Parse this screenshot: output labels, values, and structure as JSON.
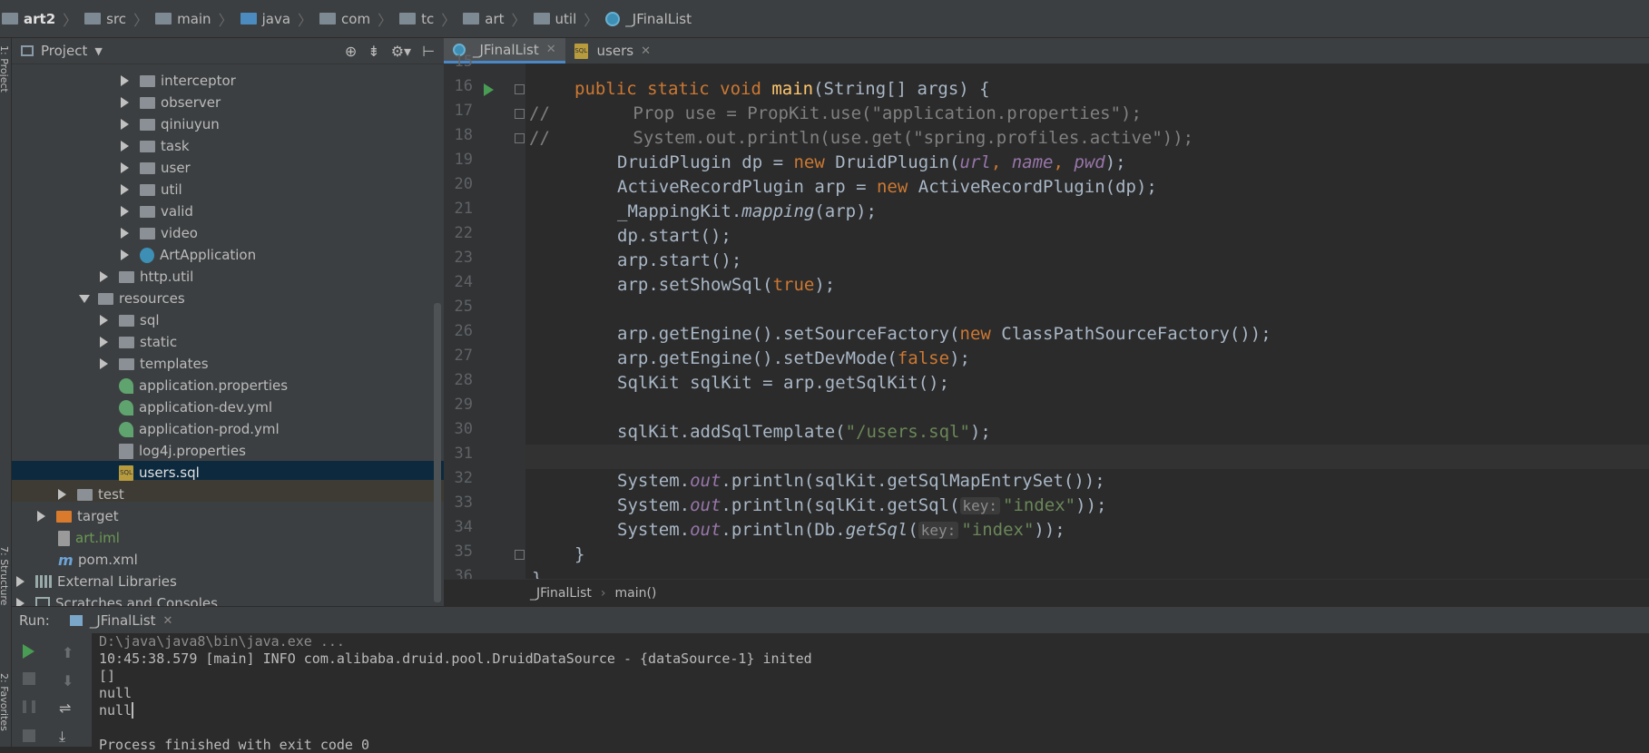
{
  "breadcrumb": {
    "items": [
      "art2",
      "src",
      "main",
      "java",
      "com",
      "tc",
      "art",
      "util",
      "_JFinalList"
    ]
  },
  "side_tabs": {
    "project": "1: Project",
    "structure": "7: Structure",
    "favorites": "2: Favorites"
  },
  "project_panel": {
    "title": "Project",
    "tree": [
      {
        "label": "interceptor",
        "type": "folder"
      },
      {
        "label": "observer",
        "type": "folder"
      },
      {
        "label": "qiniuyun",
        "type": "folder"
      },
      {
        "label": "task",
        "type": "folder"
      },
      {
        "label": "user",
        "type": "folder"
      },
      {
        "label": "util",
        "type": "folder"
      },
      {
        "label": "valid",
        "type": "folder"
      },
      {
        "label": "video",
        "type": "folder"
      },
      {
        "label": "ArtApplication",
        "type": "class"
      },
      {
        "label": "http.util",
        "type": "folder"
      },
      {
        "label": "resources",
        "type": "folder-open"
      },
      {
        "label": "sql",
        "type": "folder"
      },
      {
        "label": "static",
        "type": "folder"
      },
      {
        "label": "templates",
        "type": "folder"
      },
      {
        "label": "application.properties",
        "type": "spring-file"
      },
      {
        "label": "application-dev.yml",
        "type": "spring-file"
      },
      {
        "label": "application-prod.yml",
        "type": "spring-file"
      },
      {
        "label": "log4j.properties",
        "type": "log-file"
      },
      {
        "label": "users.sql",
        "type": "sql-file",
        "selected": true
      },
      {
        "label": "test",
        "type": "folder"
      },
      {
        "label": "target",
        "type": "folder-orange"
      },
      {
        "label": "art.iml",
        "type": "iml-file"
      },
      {
        "label": "pom.xml",
        "type": "maven-file"
      },
      {
        "label": "External Libraries",
        "type": "libraries"
      },
      {
        "label": "Scratches and Consoles",
        "type": "scratches"
      }
    ]
  },
  "editor": {
    "tabs": [
      {
        "label": "_JFinalList",
        "active": true
      },
      {
        "label": "users",
        "active": false
      }
    ],
    "line_numbers": [
      "15",
      "16",
      "17",
      "18",
      "19",
      "20",
      "21",
      "22",
      "23",
      "24",
      "25",
      "26",
      "27",
      "28",
      "29",
      "30",
      "31",
      "32",
      "33",
      "34",
      "35",
      "36"
    ],
    "code": {
      "l16": [
        "public static void ",
        "main",
        "(String[] args) {"
      ],
      "l17": "//        Prop use = PropKit.use(\"application.properties\");",
      "l18": "//        System.out.println(use.get(\"spring.profiles.active\"));",
      "l19": [
        "DruidPlugin dp = ",
        "new ",
        "DruidPlugin(",
        "url",
        ", ",
        "name",
        ", ",
        "pwd",
        ");"
      ],
      "l20": [
        "ActiveRecordPlugin arp = ",
        "new ",
        "ActiveRecordPlugin(dp);"
      ],
      "l21": [
        "_MappingKit.",
        "mapping",
        "(arp);"
      ],
      "l22": "dp.start();",
      "l23": "arp.start();",
      "l24": [
        "arp.setShowSql(",
        "true",
        ");"
      ],
      "l26": [
        "arp.getEngine().setSourceFactory(",
        "new ",
        "ClassPathSourceFactory());"
      ],
      "l27": [
        "arp.getEngine().setDevMode(",
        "false",
        ");"
      ],
      "l28": "SqlKit sqlKit = arp.getSqlKit();",
      "l30": [
        "sqlKit.addSqlTemplate(",
        "\"/users.sql\"",
        ");"
      ],
      "l32": [
        "System.",
        "out",
        ".println(sqlKit.getSqlMapEntrySet());"
      ],
      "l33": [
        "System.",
        "out",
        ".println(sqlKit.getSql(",
        "key:",
        "\"index\"",
        "));"
      ],
      "l34": [
        "System.",
        "out",
        ".println(Db.",
        "getSql",
        "(",
        "key:",
        "\"index\"",
        "));"
      ],
      "l35": "}",
      "l36": "}"
    },
    "breadcrumb": [
      "_JFinalList",
      "main()"
    ]
  },
  "run_panel": {
    "label": "Run:",
    "tab": "_JFinalList",
    "console_lines": [
      "D:\\java\\java8\\bin\\java.exe ...",
      "10:45:38.579 [main] INFO com.alibaba.druid.pool.DruidDataSource - {dataSource-1} inited",
      "[]",
      "null",
      "null",
      "",
      "Process finished with exit code 0"
    ]
  },
  "colors": {
    "background": "#2b2b2b",
    "panel": "#3c3f41",
    "keyword": "#cc7832",
    "string": "#6a8759",
    "method": "#ffc66d",
    "field": "#9876aa",
    "comment": "#808080",
    "selection": "#0d293e"
  }
}
